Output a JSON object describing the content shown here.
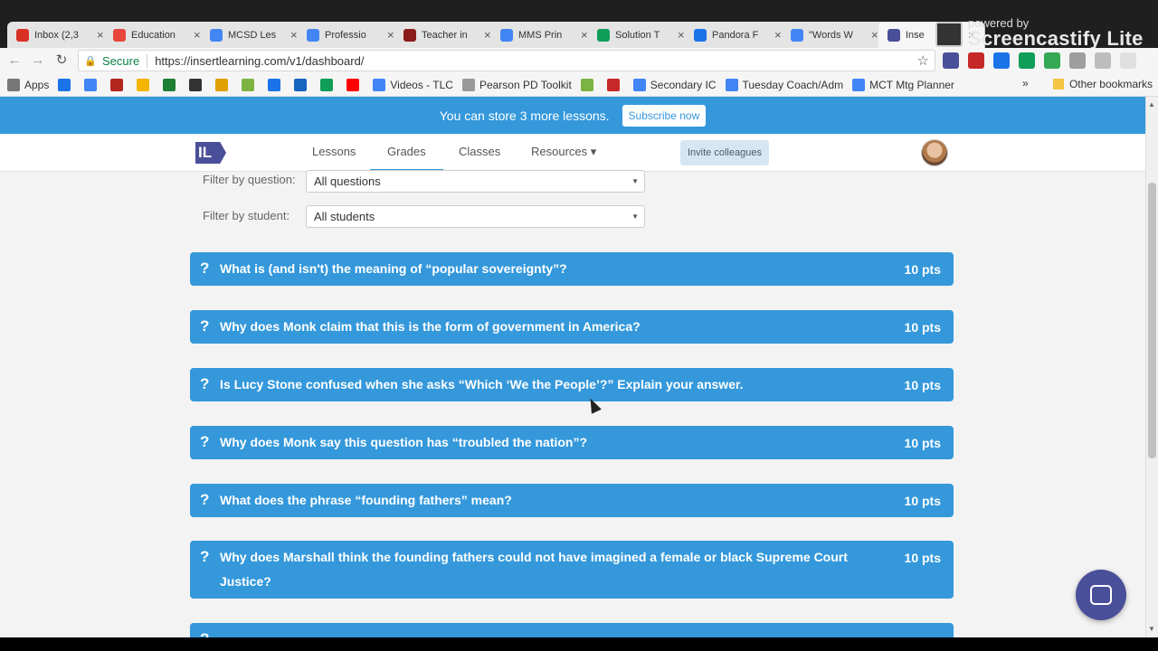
{
  "browser": {
    "tabs": [
      {
        "label": "Inbox (2,3",
        "color": "#d93025",
        "icon": "gmail-icon",
        "active": false
      },
      {
        "label": "Education",
        "color": "#e8453c",
        "icon": "windows-icon",
        "active": false
      },
      {
        "label": "MCSD Les",
        "color": "#4285f4",
        "icon": "docs-icon",
        "active": false
      },
      {
        "label": "Professio",
        "color": "#4285f4",
        "icon": "docs-icon",
        "active": false
      },
      {
        "label": "Teacher in",
        "color": "#8b1a1a",
        "icon": "apple-icon",
        "active": false
      },
      {
        "label": "MMS Prin",
        "color": "#4285f4",
        "icon": "docs-icon",
        "active": false
      },
      {
        "label": "Solution T",
        "color": "#0f9d58",
        "icon": "drive-icon",
        "active": false
      },
      {
        "label": "Pandora F",
        "color": "#1a73e8",
        "icon": "pandora-icon",
        "active": false
      },
      {
        "label": "\"Words W",
        "color": "#4285f4",
        "icon": "docs-icon",
        "active": false
      },
      {
        "label": "Inse",
        "color": "#4a4f9a",
        "icon": "insertlearning-icon",
        "active": true
      }
    ],
    "screencastify": {
      "powered": "powered by",
      "brand": "Screencastify Lite"
    },
    "secure_label": "Secure",
    "url": "https://insertlearning.com/v1/dashboard/",
    "bookmarks": [
      {
        "label": "Apps",
        "color": "#777"
      },
      {
        "label": "",
        "color": "#1a73e8"
      },
      {
        "label": "",
        "color": "#4285f4"
      },
      {
        "label": "",
        "color": "#b3261e"
      },
      {
        "label": "",
        "color": "#f4b400"
      },
      {
        "label": "",
        "color": "#1e7e34"
      },
      {
        "label": "",
        "color": "#333"
      },
      {
        "label": "",
        "color": "#e0a000"
      },
      {
        "label": "",
        "color": "#7cb342"
      },
      {
        "label": "",
        "color": "#1a73e8"
      },
      {
        "label": "",
        "color": "#1565c0"
      },
      {
        "label": "",
        "color": "#0f9d58"
      },
      {
        "label": "",
        "color": "#ff0000"
      },
      {
        "label": "Videos - TLC",
        "color": "#4285f4"
      },
      {
        "label": "Pearson PD Toolkit",
        "color": "#999"
      },
      {
        "label": "",
        "color": "#7cb342"
      },
      {
        "label": "",
        "color": "#c62828"
      },
      {
        "label": "Secondary IC",
        "color": "#4285f4"
      },
      {
        "label": "Tuesday Coach/Adm",
        "color": "#4285f4"
      },
      {
        "label": "MCT Mtg Planner",
        "color": "#4285f4"
      }
    ],
    "other_bookmarks": "Other bookmarks"
  },
  "banner": {
    "text": "You can store 3 more lessons.",
    "button": "Subscribe now"
  },
  "nav": {
    "logo": "IL",
    "links": [
      "Lessons",
      "Grades",
      "Classes",
      "Resources ▾"
    ],
    "invite": "Invite colleagues"
  },
  "filters": {
    "question_label": "Filter by question:",
    "question_value": "All questions",
    "student_label": "Filter by student:",
    "student_value": "All students"
  },
  "questions": [
    {
      "text": "What is (and isn't) the meaning of “popular sovereignty”?",
      "points": "10 pts"
    },
    {
      "text": "Why does Monk claim that this is the form of government in America?",
      "points": "10 pts"
    },
    {
      "text": "Is Lucy Stone confused when she asks “Which ‘We the People’?” Explain your answer.",
      "points": "10 pts"
    },
    {
      "text": "Why does Monk say this question has “troubled the nation”?",
      "points": "10 pts"
    },
    {
      "text": "What does the phrase “founding fathers” mean?",
      "points": "10 pts"
    },
    {
      "text": "Why does Marshall think the founding fathers could not have imagined a female or black Supreme Court Justice?",
      "points": "10 pts"
    },
    {
      "text": "",
      "points": ""
    }
  ]
}
